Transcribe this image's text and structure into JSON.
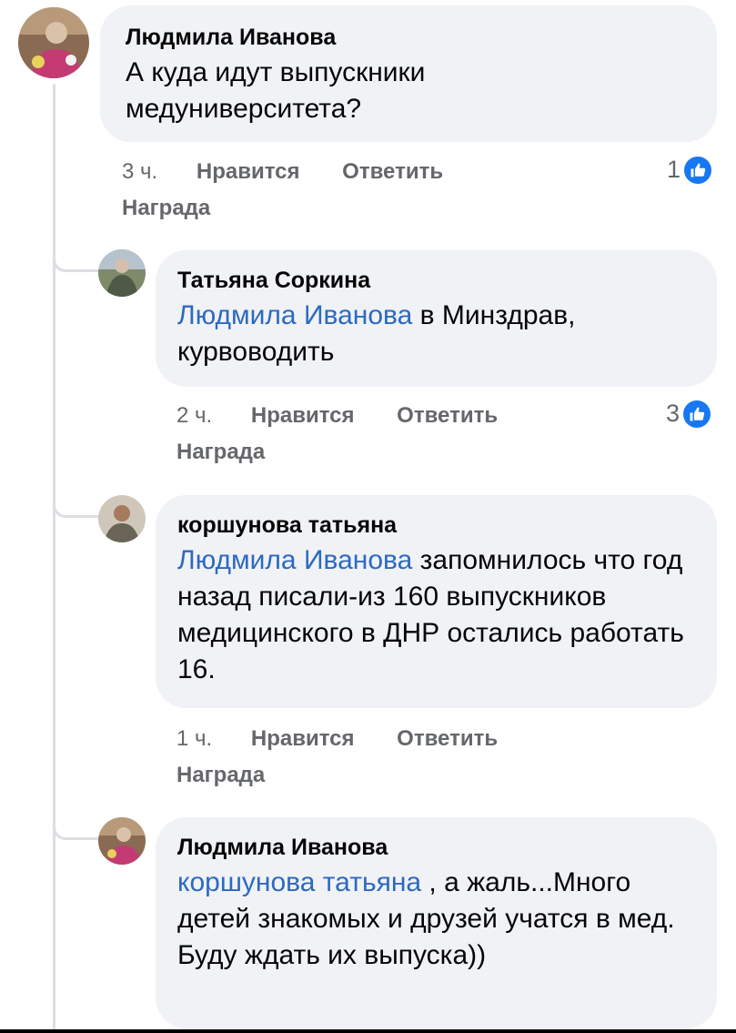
{
  "comments": [
    {
      "author": "Людмила Иванова",
      "text": "А куда идут выпускники медуниверситета?",
      "time": "3 ч.",
      "like_label": "Нравится",
      "reply_label": "Ответить",
      "award_label": "Награда",
      "reaction_count": "1"
    },
    {
      "author": "Татьяна Соркина",
      "mention": "Людмила Иванова",
      "text": " в Минздрав, курвоводить",
      "time": "2 ч.",
      "like_label": "Нравится",
      "reply_label": "Ответить",
      "award_label": "Награда",
      "reaction_count": "3"
    },
    {
      "author": "коршунова татьяна",
      "mention": "Людмила Иванова",
      "text": " запомнилось что год назад писали-из 160 выпускников медицинского в ДНР остались работать 16.",
      "time": "1 ч.",
      "like_label": "Нравится",
      "reply_label": "Ответить",
      "award_label": "Награда"
    },
    {
      "author": "Людмила Иванова",
      "mention": "коршунова татьяна",
      "text": " , а жаль...Много детей знакомых и друзей учатся в мед. Буду ждать их выпуска))"
    }
  ],
  "colors": {
    "bubble": "#f0f2f5",
    "mention": "#2d69c1",
    "meta": "#65676b",
    "like_badge": "#1877f2",
    "thread_line": "#dcdee2"
  },
  "icons": {
    "like_badge": "thumbs-up-icon"
  }
}
